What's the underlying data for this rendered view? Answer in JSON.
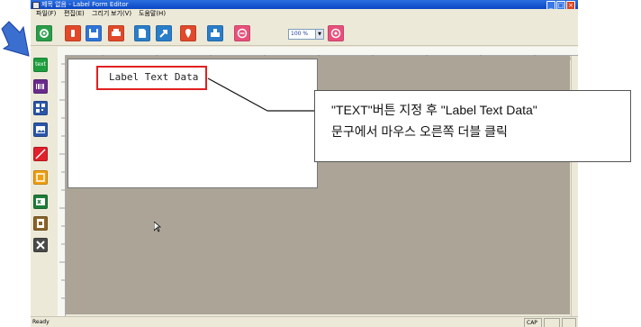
{
  "window": {
    "title": "제목 없음 - Label Form Editor",
    "min_glyph": "_",
    "max_glyph": "□",
    "close_glyph": "×"
  },
  "menu": {
    "items": [
      "파일(F)",
      "편집(E)",
      "그리기",
      "보기(V)",
      "도움말(H)"
    ]
  },
  "toolbar": {
    "buttons": [
      {
        "name": "refresh-icon",
        "color": "#2a9d48"
      },
      {
        "name": "open-icon",
        "color": "#e0492a"
      },
      {
        "name": "save-icon",
        "color": "#2f74d8"
      },
      {
        "name": "print-icon",
        "color": "#e0492a"
      },
      {
        "name": "import-icon",
        "color": "#2a7dc8"
      },
      {
        "name": "export-icon",
        "color": "#2a7dc8"
      },
      {
        "name": "location-icon",
        "color": "#e0492a"
      },
      {
        "name": "printer-settings-icon",
        "color": "#2a7dc8"
      },
      {
        "name": "zoom-out-icon",
        "color": "#e8507c"
      },
      {
        "name": "zoom-in-icon",
        "color": "#e8507c"
      }
    ],
    "zoom_value": "100 %"
  },
  "left_tools": [
    {
      "name": "text-tool",
      "label": "text",
      "color": "#1f9e3f"
    },
    {
      "name": "barcode-tool",
      "color": "#6a2b8c"
    },
    {
      "name": "qrcode-tool",
      "color": "#2b55a8"
    },
    {
      "name": "image-tool",
      "color": "#2b55a8"
    },
    {
      "name": "line-tool",
      "color": "#e0202a"
    },
    {
      "name": "rectangle-tool",
      "color": "#f2a010"
    },
    {
      "name": "excel-tool",
      "color": "#1f7d3a"
    },
    {
      "name": "edit-tool",
      "color": "#8a6428"
    },
    {
      "name": "settings-tool",
      "color": "#4a4a4a"
    }
  ],
  "canvas": {
    "label_text": "Label Text Data"
  },
  "callout": {
    "line1": "\"TEXT\"버튼 지정 후 \"Label Text Data\"",
    "line2": "문구에서 마우스 오른쪽 더블 클릭"
  },
  "status": {
    "ready": "Ready",
    "cap": "CAP"
  },
  "colors": {
    "arrow": "#3a6fd0",
    "highlight": "#e02020",
    "work_area": "#aba497"
  }
}
